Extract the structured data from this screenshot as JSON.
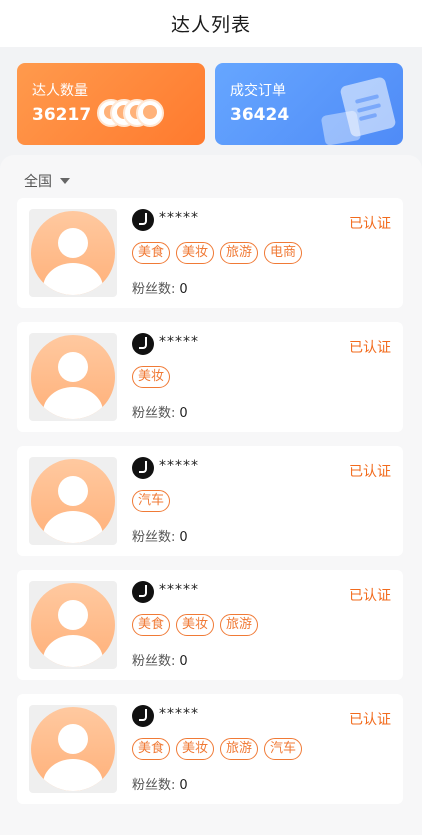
{
  "header": {
    "title": "达人列表"
  },
  "stats": {
    "influencers": {
      "label": "达人数量",
      "value": "36217"
    },
    "orders": {
      "label": "成交订单",
      "value": "36424"
    }
  },
  "filter": {
    "label": "全国"
  },
  "colors": {
    "accent_orange": "#f26b1d",
    "card_blue": "#4f8bf7"
  },
  "list": [
    {
      "name": "*****",
      "status": "已认证",
      "tags": [
        "美食",
        "美妆",
        "旅游",
        "电商"
      ],
      "fans_label": "粉丝数:",
      "fans": "0"
    },
    {
      "name": "*****",
      "status": "已认证",
      "tags": [
        "美妆"
      ],
      "fans_label": "粉丝数:",
      "fans": "0"
    },
    {
      "name": "*****",
      "status": "已认证",
      "tags": [
        "汽车"
      ],
      "fans_label": "粉丝数:",
      "fans": "0"
    },
    {
      "name": "*****",
      "status": "已认证",
      "tags": [
        "美食",
        "美妆",
        "旅游"
      ],
      "fans_label": "粉丝数:",
      "fans": "0"
    },
    {
      "name": "*****",
      "status": "已认证",
      "tags": [
        "美食",
        "美妆",
        "旅游",
        "汽车"
      ],
      "fans_label": "粉丝数:",
      "fans": "0"
    }
  ]
}
